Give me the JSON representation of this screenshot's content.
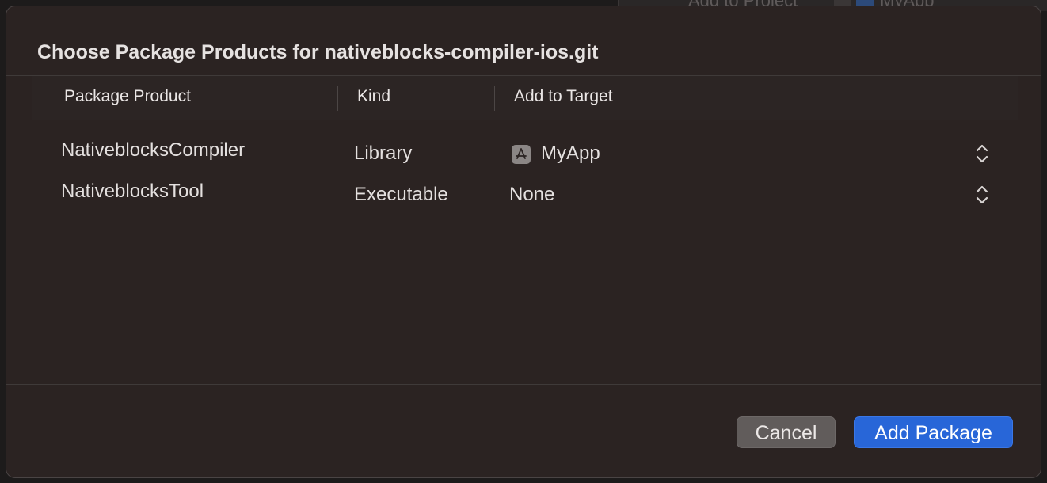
{
  "background_window": {
    "toolbar_text": "Add to Project",
    "app_name": "MyApp"
  },
  "dialog": {
    "title": "Choose Package Products for nativeblocks-compiler-ios.git"
  },
  "table": {
    "columns": [
      "Package Product",
      "Kind",
      "Add to Target"
    ],
    "rows": [
      {
        "product": "NativeblocksCompiler",
        "kind": "Library",
        "target": "MyApp",
        "target_icon": "app-icon"
      },
      {
        "product": "NativeblocksTool",
        "kind": "Executable",
        "target": "None",
        "target_icon": ""
      }
    ]
  },
  "buttons": {
    "cancel": "Cancel",
    "primary": "Add Package"
  },
  "colors": {
    "accent": "#2866d8",
    "sheet_bg": "#2b2322"
  }
}
